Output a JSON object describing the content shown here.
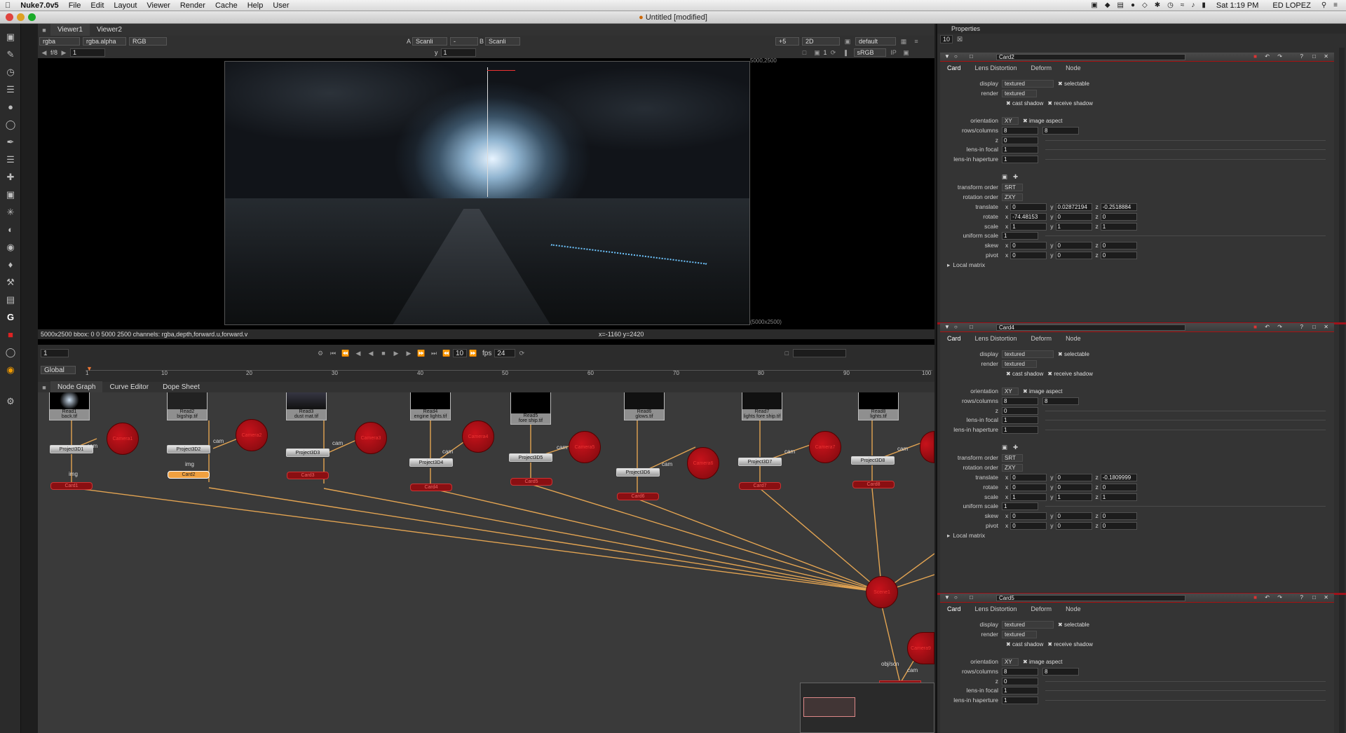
{
  "menubar": {
    "app": "Nuke7.0v5",
    "items": [
      "File",
      "Edit",
      "Layout",
      "Viewer",
      "Render",
      "Cache",
      "Help",
      "User"
    ],
    "clock": "Sat 1:19 PM",
    "user": "ED LOPEZ"
  },
  "window": {
    "title": "Untitled [modified]"
  },
  "viewer": {
    "tabs": [
      "Viewer1",
      "Viewer2"
    ],
    "channels": "rgba",
    "alpha": "rgba.alpha",
    "display": "RGB",
    "a_label": "A",
    "a_input": "Scanli",
    "a_dash": "-",
    "b_label": "B",
    "b_input": "Scanli",
    "zoom": "+5",
    "mode": "2D",
    "lut_default": "default",
    "fstop": "f/8",
    "frame": "1",
    "y_label": "y",
    "y_value": "1",
    "proxy": "1",
    "colorspace": "sRGB",
    "res_top": "5000,2500",
    "res_bottom": "(5000x2500)",
    "status": "5000x2500  bbox: 0 0 5000 2500  channels: rgba,depth,forward.u,forward.v",
    "coords": "x=-1160 y=2420"
  },
  "timeline": {
    "frame_field": "1",
    "step": "10",
    "fps_label": "fps",
    "fps": "24",
    "range": "Global",
    "ticks": [
      "1",
      "10",
      "20",
      "30",
      "40",
      "50",
      "60",
      "70",
      "80",
      "90",
      "100"
    ]
  },
  "nodegraph": {
    "tabs": [
      "Node Graph",
      "Curve Editor",
      "Dope Sheet"
    ],
    "reads": [
      {
        "name": "Read1",
        "file": "back.tif"
      },
      {
        "name": "Read2",
        "file": "bigship.tif"
      },
      {
        "name": "Read3",
        "file": "dust mat.tif"
      },
      {
        "name": "Read4",
        "file": "engine lights.tif"
      },
      {
        "name": "Read5",
        "file": "fore ship.tif"
      },
      {
        "name": "Read6",
        "file": "glows.tif"
      },
      {
        "name": "Read7",
        "file": "lights fore ship.tif"
      },
      {
        "name": "Read8",
        "file": "lights.tif"
      }
    ],
    "projects": [
      "Project3D1",
      "Project3D2",
      "Project3D3",
      "Project3D4",
      "Project3D5",
      "Project3D6",
      "Project3D7",
      "Project3D8"
    ],
    "cards": [
      "Card1",
      "Card2",
      "Card3",
      "Card4",
      "Card5",
      "Card6",
      "Card7",
      "Card8"
    ],
    "cameras": [
      "Camera1",
      "Camera2",
      "Camera3",
      "Camera4",
      "Camera5",
      "Camera6",
      "Camera7",
      "Camera8",
      "Camera9"
    ],
    "cam_label": "cam",
    "img_label": "img",
    "obj_label": "obj/scn",
    "scene": "Scene1"
  },
  "properties": {
    "title": "Properties",
    "max_panels": "10",
    "panels": [
      {
        "name": "Card2",
        "tabs": [
          "Card",
          "Lens Distortion",
          "Deform",
          "Node"
        ],
        "display": "textured",
        "selectable": "selectable",
        "render": "textured",
        "cast_shadow": "cast shadow",
        "receive_shadow": "receive shadow",
        "orientation": "XY",
        "image_aspect": "image aspect",
        "rows": "8",
        "columns": "8",
        "z": "0",
        "lens_focal": "1",
        "lens_haperture": "1",
        "transform_order": "SRT",
        "rotation_order": "ZXY",
        "translate": [
          "0",
          "0.02872194",
          "-0.2518884"
        ],
        "rotate": [
          "-74.48153",
          "0",
          "0"
        ],
        "scale": [
          "1",
          "1",
          "1"
        ],
        "uniform_scale": "1",
        "skew": [
          "0",
          "0",
          "0"
        ],
        "pivot": [
          "0",
          "0",
          "0"
        ],
        "local_matrix": "Local matrix"
      },
      {
        "name": "Card4",
        "tabs": [
          "Card",
          "Lens Distortion",
          "Deform",
          "Node"
        ],
        "display": "textured",
        "selectable": "selectable",
        "render": "textured",
        "cast_shadow": "cast shadow",
        "receive_shadow": "receive shadow",
        "orientation": "XY",
        "image_aspect": "image aspect",
        "rows": "8",
        "columns": "8",
        "z": "0",
        "lens_focal": "1",
        "lens_haperture": "1",
        "transform_order": "SRT",
        "rotation_order": "ZXY",
        "translate": [
          "0",
          "0",
          "-0.1809999"
        ],
        "rotate": [
          "0",
          "0",
          "0"
        ],
        "scale": [
          "1",
          "1",
          "1"
        ],
        "uniform_scale": "1",
        "skew": [
          "0",
          "0",
          "0"
        ],
        "pivot": [
          "0",
          "0",
          "0"
        ],
        "local_matrix": "Local matrix"
      },
      {
        "name": "Card5",
        "tabs": [
          "Card",
          "Lens Distortion",
          "Deform",
          "Node"
        ],
        "display": "textured",
        "selectable": "selectable",
        "render": "textured",
        "cast_shadow": "cast shadow",
        "receive_shadow": "receive shadow",
        "orientation": "XY",
        "image_aspect": "image aspect",
        "rows": "8",
        "columns": "8",
        "z": "0",
        "lens_focal": "1",
        "lens_haperture": "1"
      }
    ],
    "labels": {
      "display": "display",
      "render": "render",
      "orientation": "orientation",
      "rows_columns": "rows/columns",
      "z": "z",
      "lens_focal": "lens-in focal",
      "lens_haperture": "lens-in haperture",
      "transform_order": "transform order",
      "rotation_order": "rotation order",
      "translate": "translate",
      "rotate": "rotate",
      "scale": "scale",
      "uniform_scale": "uniform scale",
      "skew": "skew",
      "pivot": "pivot",
      "x": "x",
      "y": "y",
      "zc": "z"
    }
  }
}
